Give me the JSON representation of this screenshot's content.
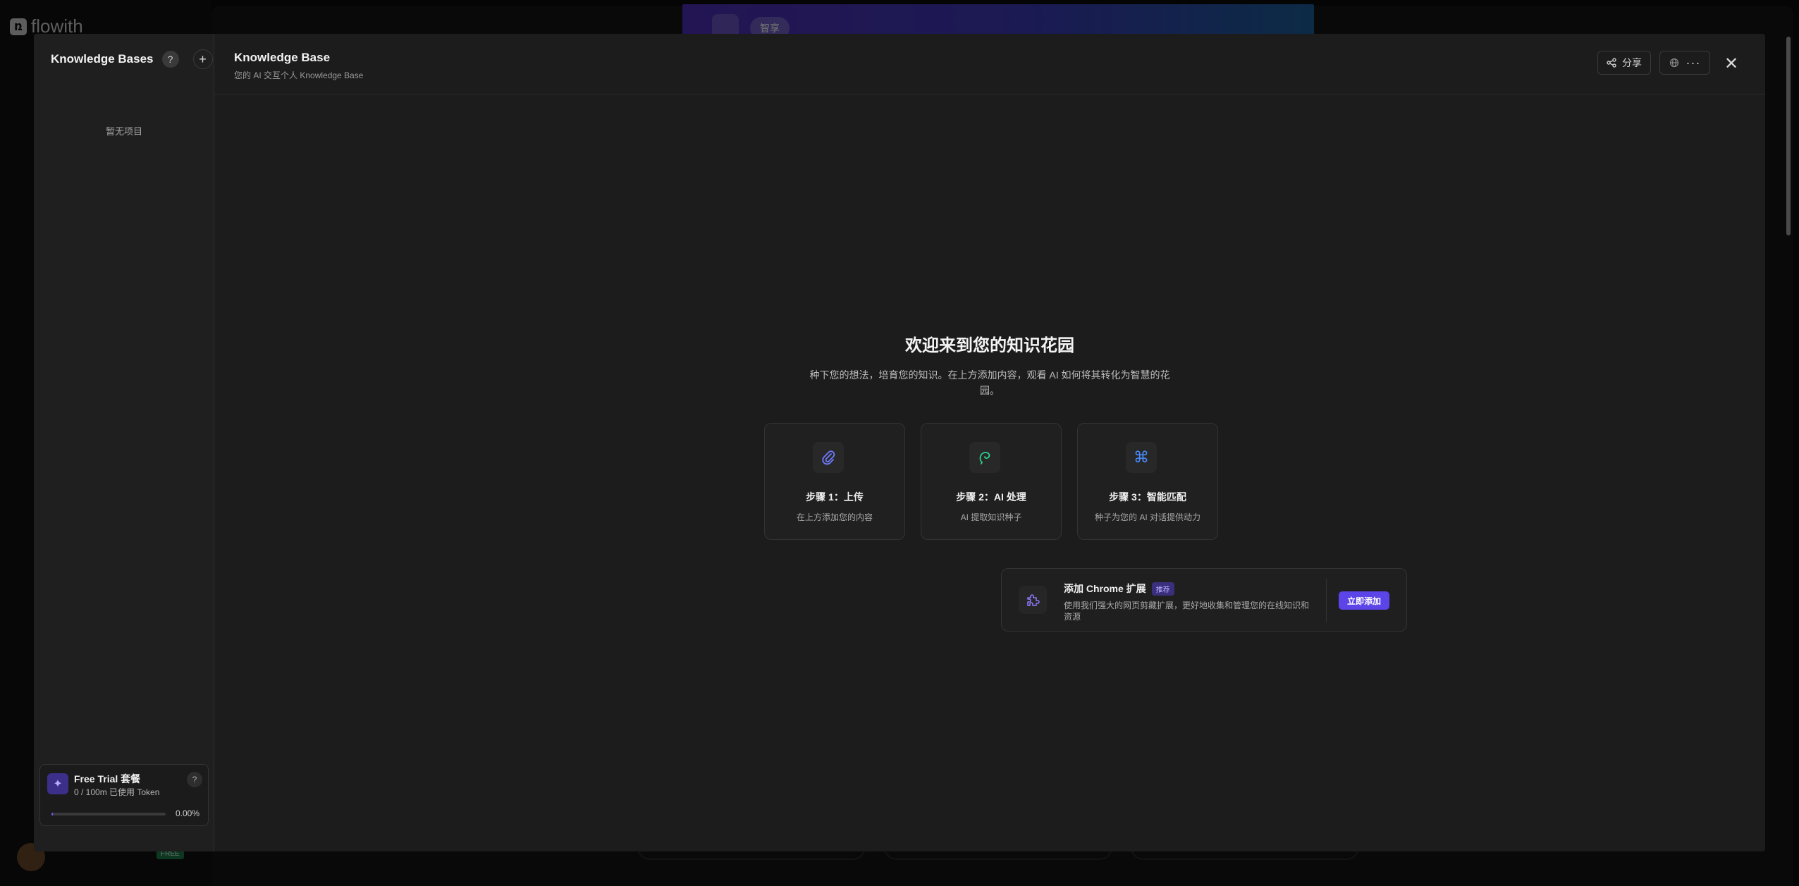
{
  "background": {
    "brand": "flowith",
    "banner_chip": "智享"
  },
  "sidebar": {
    "title": "Knowledge Bases",
    "help_icon": "question-icon",
    "add_icon": "plus-icon",
    "empty_text": "暂无项目"
  },
  "plan": {
    "name": "Free Trial 套餐",
    "usage": "0 / 100m 已使用 Token",
    "percent": "0.00%",
    "progress_fraction": 0.0,
    "accent": "#6a5cff"
  },
  "header": {
    "title": "Knowledge Base",
    "subtitle": "您的 AI 交互个人 Knowledge Base",
    "share_label": "分享",
    "more_icon": "more-icon",
    "close_icon": "close-icon"
  },
  "welcome": {
    "title": "欢迎来到您的知识花园",
    "description": "种下您的想法，培育您的知识。在上方添加内容，观看 AI 如何将其转化为智慧的花园。"
  },
  "steps": [
    {
      "title": "步骤 1：上传",
      "desc": "在上方添加您的内容",
      "icon": "paperclip-icon",
      "color": "#6f7cff"
    },
    {
      "title": "步骤 2：AI 处理",
      "desc": "AI 提取知识种子",
      "icon": "seed-icon",
      "color": "#2fd08a"
    },
    {
      "title": "步骤 3：智能匹配",
      "desc": "种子为您的 AI 对话提供动力",
      "icon": "command-icon",
      "color": "#4a8bff"
    }
  ],
  "chrome": {
    "title": "添加 Chrome 扩展",
    "badge": "推荐",
    "desc": "使用我们强大的网页剪藏扩展，更好地收集和管理您的在线知识和资源",
    "button": "立即添加",
    "icon": "puzzle-icon"
  }
}
